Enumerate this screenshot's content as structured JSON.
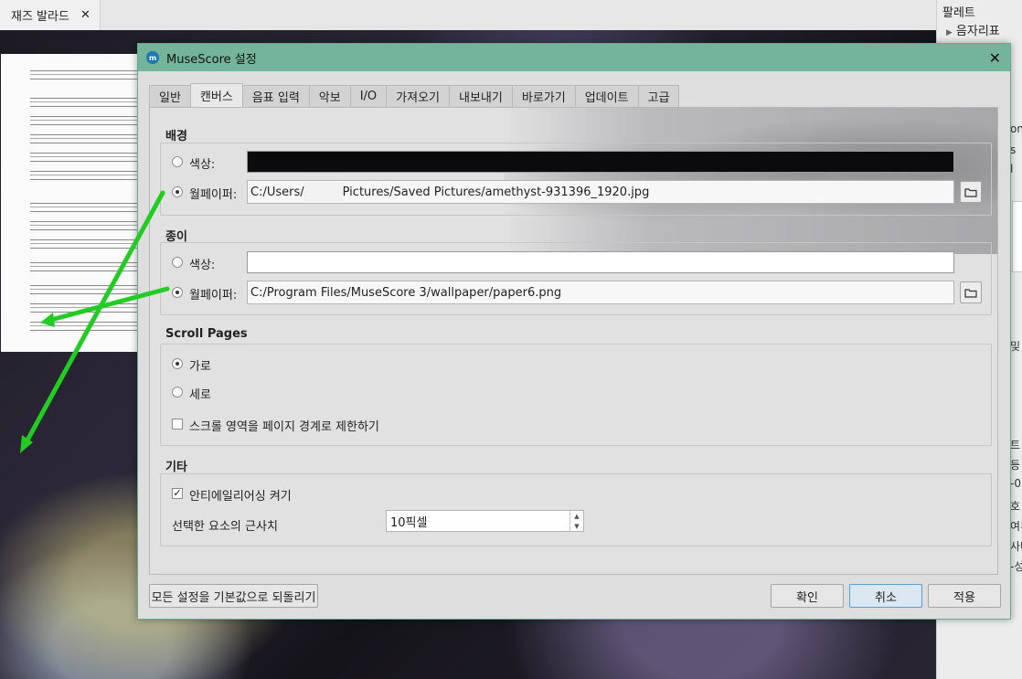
{
  "doc_tab": {
    "label": "재즈 발라드",
    "close": "✕"
  },
  "side_panel": {
    "title": "팔레트",
    "item": "음자리표",
    "clip_texts": [
      "on",
      "s",
      "l",
      "및",
      "트",
      "등",
      "-0",
      "호",
      "여부",
      "사다",
      "-성"
    ]
  },
  "dialog": {
    "title": "MuseScore 설정",
    "close": "✕",
    "tabs": [
      "일반",
      "캔버스",
      "음표 입력",
      "악보",
      "I/O",
      "가져오기",
      "내보내기",
      "바로가기",
      "업데이트",
      "고급"
    ],
    "active_tab": "캔버스",
    "background": {
      "title": "배경",
      "color_label": "색상:",
      "color_value": "#0b0a0d",
      "wallpaper_label": "월페이퍼:",
      "wallpaper_path_1": "C:/Users/",
      "wallpaper_path_2": "Pictures/Saved Pictures/amethyst-931396_1920.jpg",
      "selected": "wallpaper"
    },
    "paper": {
      "title": "종이",
      "color_label": "색상:",
      "color_value": "#ffffff",
      "wallpaper_label": "월페이퍼:",
      "wallpaper_path": "C:/Program Files/MuseScore 3/wallpaper/paper6.png",
      "selected": "wallpaper"
    },
    "scroll": {
      "title": "Scroll Pages",
      "horizontal": "가로",
      "vertical": "세로",
      "selected": "horizontal",
      "limit_label": "스크롤 영역을 페이지 경계로 제한하기",
      "limit_checked": false
    },
    "misc": {
      "title": "기타",
      "antialias_label": "안티에일리어싱 켜기",
      "antialias_checked": true,
      "proximity_label": "선택한 요소의 근사치",
      "proximity_value": "10픽셀"
    },
    "buttons": {
      "reset": "모든 설정을 기본값으로 되돌리기",
      "ok": "확인",
      "cancel": "취소",
      "apply": "적용"
    }
  },
  "colors": {
    "titlebar": "#73b49b",
    "arrow": "#22cc22",
    "focus": "#5a9fd4"
  }
}
